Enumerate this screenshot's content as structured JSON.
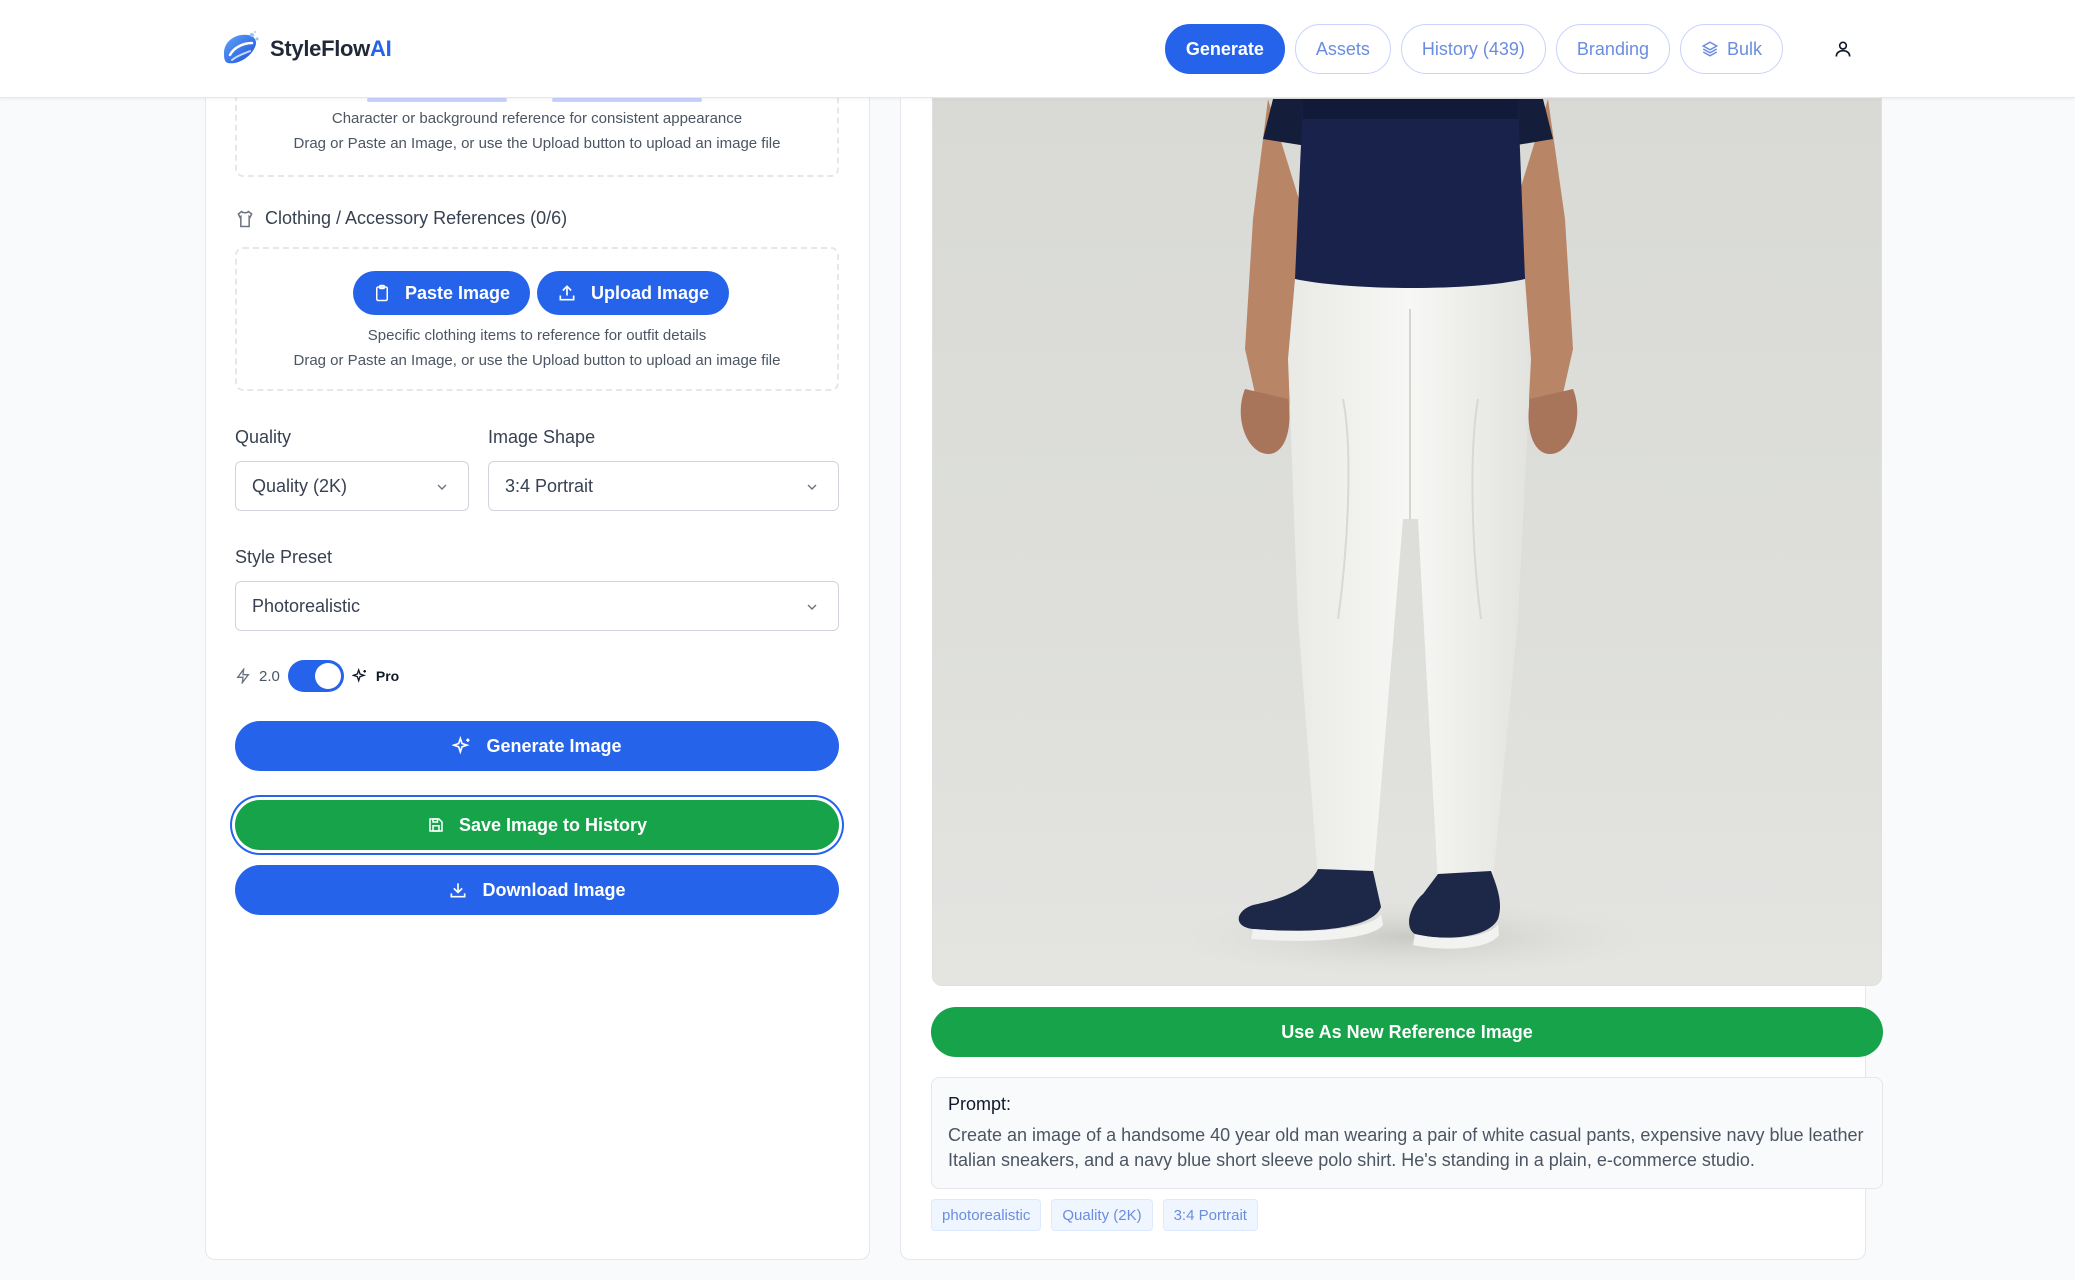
{
  "header": {
    "brand_name": "StyleFlow",
    "brand_suffix": "AI",
    "nav": [
      {
        "label": "Generate",
        "active": true
      },
      {
        "label": "Assets"
      },
      {
        "label": "History (439)"
      },
      {
        "label": "Branding"
      },
      {
        "label": "Bulk",
        "icon": "layers-icon"
      }
    ]
  },
  "left": {
    "character_ref": {
      "line1": "Character or background reference for consistent appearance",
      "line2": "Drag or Paste an Image, or use the Upload button to upload an image file"
    },
    "clothing_ref": {
      "title": "Clothing / Accessory References (0/6)",
      "paste_label": "Paste Image",
      "upload_label": "Upload Image",
      "line1": "Specific clothing items to reference for outfit details",
      "line2": "Drag or Paste an Image, or use the Upload button to upload an image file"
    },
    "quality": {
      "label": "Quality",
      "value": "Quality (2K)"
    },
    "image_shape": {
      "label": "Image Shape",
      "value": "3:4 Portrait"
    },
    "style_preset": {
      "label": "Style Preset",
      "value": "Photorealistic"
    },
    "model_toggle": {
      "left_label": "2.0",
      "right_label": "Pro",
      "on": true
    },
    "generate_label": "Generate Image",
    "save_label": "Save Image to History",
    "download_label": "Download Image"
  },
  "right": {
    "use_ref_label": "Use As New Reference Image",
    "prompt_label": "Prompt:",
    "prompt_text": "Create an image of a handsome 40 year old man wearing a pair of white casual pants, expensive navy blue leather Italian sneakers, and a navy blue short sleeve polo shirt. He's standing in a plain, e-commerce studio.",
    "tags": [
      "photorealistic",
      "Quality (2K)",
      "3:4 Portrait"
    ]
  },
  "colors": {
    "primary": "#2563eb",
    "success": "#16a34a"
  }
}
